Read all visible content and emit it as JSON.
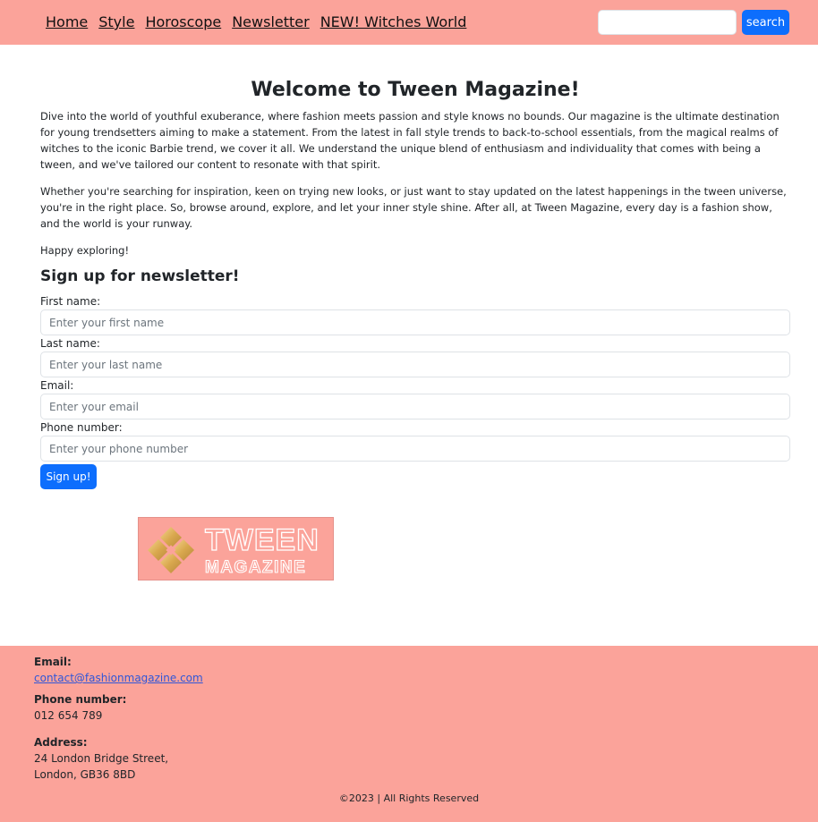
{
  "nav": {
    "links": [
      {
        "label": "Home"
      },
      {
        "label": "Style"
      },
      {
        "label": "Horoscope"
      },
      {
        "label": "Newsletter"
      },
      {
        "label": "NEW! Witches World"
      }
    ],
    "search_button": "search",
    "search_value": ""
  },
  "main": {
    "title": "Welcome to Tween Magazine!",
    "paragraphs": [
      "Dive into the world of youthful exuberance, where fashion meets passion and style knows no bounds. Our magazine is the ultimate destination for young trendsetters aiming to make a statement. From the latest in fall style trends to back-to-school essentials, from the magical realms of witches to the iconic Barbie trend, we cover it all. We understand the unique blend of enthusiasm and individuality that comes with being a tween, and we've tailored our content to resonate with that spirit.",
      "Whether you're searching for inspiration, keen on trying new looks, or just want to stay updated on the latest happenings in the tween universe, you're in the right place. So, browse around, explore, and let your inner style shine. After all, at Tween Magazine, every day is a fashion show, and the world is your runway.",
      "Happy exploring!"
    ]
  },
  "signup": {
    "heading": "Sign up for newsletter!",
    "fields": [
      {
        "label": "First name:",
        "placeholder": "Enter your first name",
        "value": ""
      },
      {
        "label": "Last name:",
        "placeholder": "Enter your last name",
        "value": ""
      },
      {
        "label": "Email:",
        "placeholder": "Enter your email",
        "value": ""
      },
      {
        "label": "Phone number:",
        "placeholder": "Enter your phone number",
        "value": ""
      }
    ],
    "submit_label": "Sign up!"
  },
  "logo": {
    "line1": "TWEEN",
    "line2": "MAGAZINE"
  },
  "footer": {
    "email_label": "Email:",
    "email": "contact@fashionmagazine.com",
    "phone_label": "Phone number:",
    "phone": "012 654 789",
    "address_label": "Address:",
    "address_line1": "24 London Bridge Street,",
    "address_line2": "London, GB36 8BD",
    "copyright": "©2023 | All Rights Reserved"
  },
  "colors": {
    "accent_pink": "#fba39a",
    "button_blue": "#0d6efd",
    "link_blue": "#2f56d8"
  }
}
